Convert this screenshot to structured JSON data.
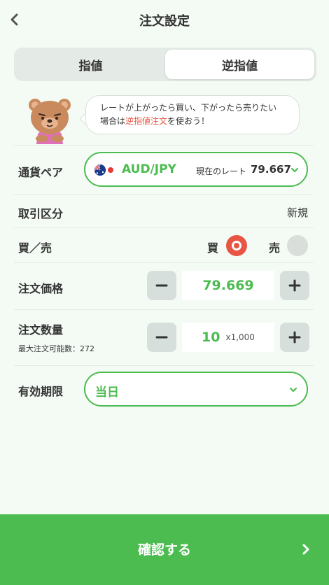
{
  "header": {
    "title": "注文設定"
  },
  "tabs": [
    {
      "label": "指値",
      "active": false
    },
    {
      "label": "逆指値",
      "active": true
    }
  ],
  "message": {
    "line1": "レートが上がったら買い、下がったら売りたい",
    "line2_before": "場合は",
    "line2_highlight": "逆指値注文",
    "line2_after": "を使おう！"
  },
  "currency_pair": {
    "label": "通貨ペア",
    "value": "AUD/JPY",
    "rate_label": "現在のレート",
    "rate_value": "79.667"
  },
  "trade_type": {
    "label": "取引区分",
    "value": "新規"
  },
  "side": {
    "label": "買／売",
    "buy_label": "買",
    "sell_label": "売",
    "selected": "buy"
  },
  "order_price": {
    "label": "注文価格",
    "value": "79.669"
  },
  "order_quantity": {
    "label": "注文数量",
    "max_label": "最大注文可能数：272",
    "value": "10",
    "unit": "x1,000"
  },
  "expiry": {
    "label": "有効期限",
    "value": "当日"
  },
  "confirm": {
    "label": "確認する"
  },
  "colors": {
    "accent": "#4cbc50",
    "sell_highlight": "#e85545",
    "background": "#f4fbf5"
  }
}
